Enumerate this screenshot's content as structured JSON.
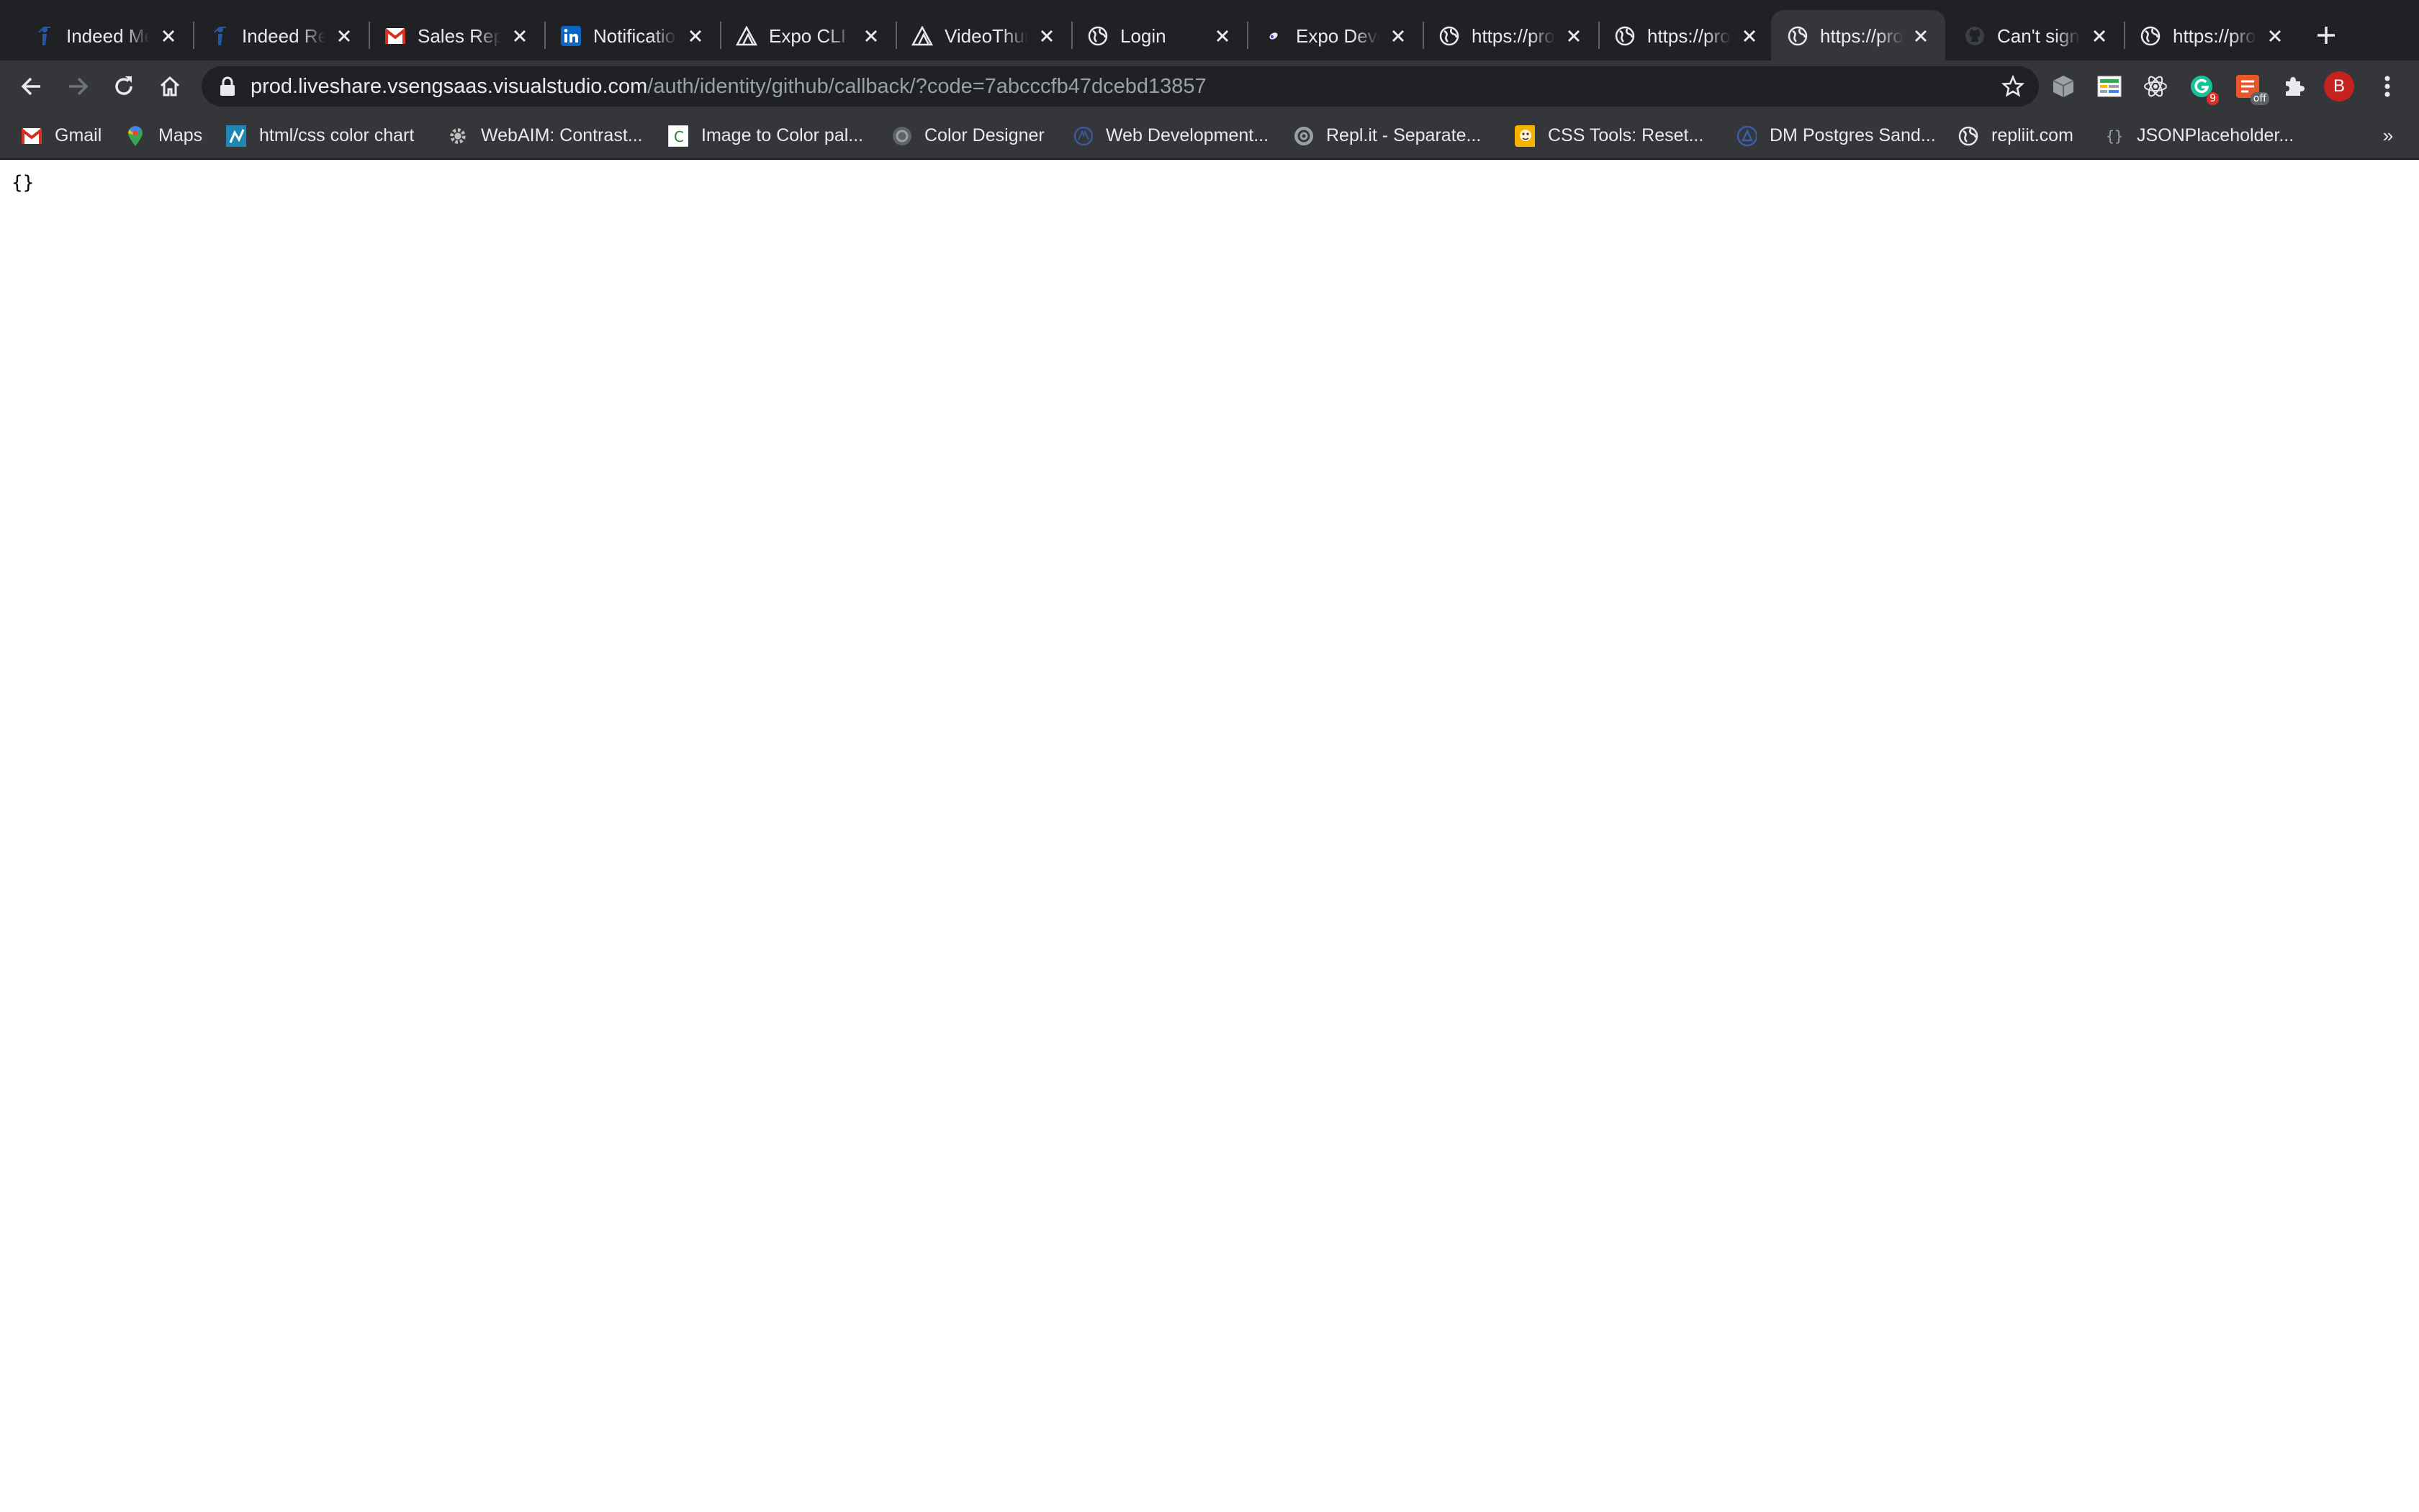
{
  "colors": {
    "tabstrip_bg": "#202124",
    "toolbar_bg": "#35363a",
    "omnibox_bg": "#202124",
    "text_primary": "#e8eaed",
    "text_secondary": "#9aa0a6",
    "avatar_bg": "#c5221f"
  },
  "tabs": [
    {
      "title": "Indeed Me",
      "icon": "indeed-icon",
      "active": false
    },
    {
      "title": "Indeed Re",
      "icon": "indeed-icon",
      "active": false
    },
    {
      "title": "Sales Rep",
      "icon": "gmail-icon",
      "active": false
    },
    {
      "title": "Notificatio",
      "icon": "linkedin-icon",
      "active": false
    },
    {
      "title": "Expo CLI -",
      "icon": "expo-icon",
      "active": false
    },
    {
      "title": "VideoThur",
      "icon": "expo-icon",
      "active": false
    },
    {
      "title": "Login",
      "icon": "globe-icon",
      "active": false
    },
    {
      "title": "Expo Deve",
      "icon": "expo-dot-icon",
      "active": false
    },
    {
      "title": "https://pro",
      "icon": "globe-icon",
      "active": false
    },
    {
      "title": "https://pro",
      "icon": "globe-icon",
      "active": false
    },
    {
      "title": "https://pro",
      "icon": "globe-icon",
      "active": true
    },
    {
      "title": "Can't sign",
      "icon": "github-icon",
      "active": false
    },
    {
      "title": "https://pro",
      "icon": "globe-icon",
      "active": false
    }
  ],
  "address_bar": {
    "host": "prod.liveshare.vsengsaas.visualstudio.com",
    "path": "/auth/identity/github/callback/?code=7abcccfb47dcebd13857"
  },
  "extensions": [
    {
      "icon": "cube-extension-icon"
    },
    {
      "icon": "sheets-extension-icon"
    },
    {
      "icon": "react-devtools-icon"
    },
    {
      "icon": "grammarly-icon",
      "badge": "9"
    },
    {
      "icon": "shield-off-extension-icon",
      "badge": "off"
    },
    {
      "icon": "puzzle-extensions-icon"
    }
  ],
  "profile": {
    "initial": "B"
  },
  "bookmarks": [
    {
      "label": "Gmail",
      "icon": "gmail-icon"
    },
    {
      "label": "Maps",
      "icon": "maps-pin-icon"
    },
    {
      "label": "html/css color chart",
      "icon": "color-chart-icon"
    },
    {
      "label": "WebAIM: Contrast...",
      "icon": "webaim-gear-icon"
    },
    {
      "label": "Image to Color pal...",
      "icon": "palette-c-icon"
    },
    {
      "label": "Color Designer",
      "icon": "color-designer-icon"
    },
    {
      "label": "Web Development...",
      "icon": "webdev-icon"
    },
    {
      "label": "Repl.it - Separate...",
      "icon": "replit-icon"
    },
    {
      "label": "CSS Tools: Reset...",
      "icon": "css-tools-icon"
    },
    {
      "label": "DM Postgres Sand...",
      "icon": "postgres-icon"
    },
    {
      "label": "repliit.com",
      "icon": "globe-icon"
    },
    {
      "label": "JSONPlaceholder...",
      "icon": "jsonplaceholder-icon"
    }
  ],
  "overflow_label": "»",
  "page": {
    "body_text": "{}"
  }
}
